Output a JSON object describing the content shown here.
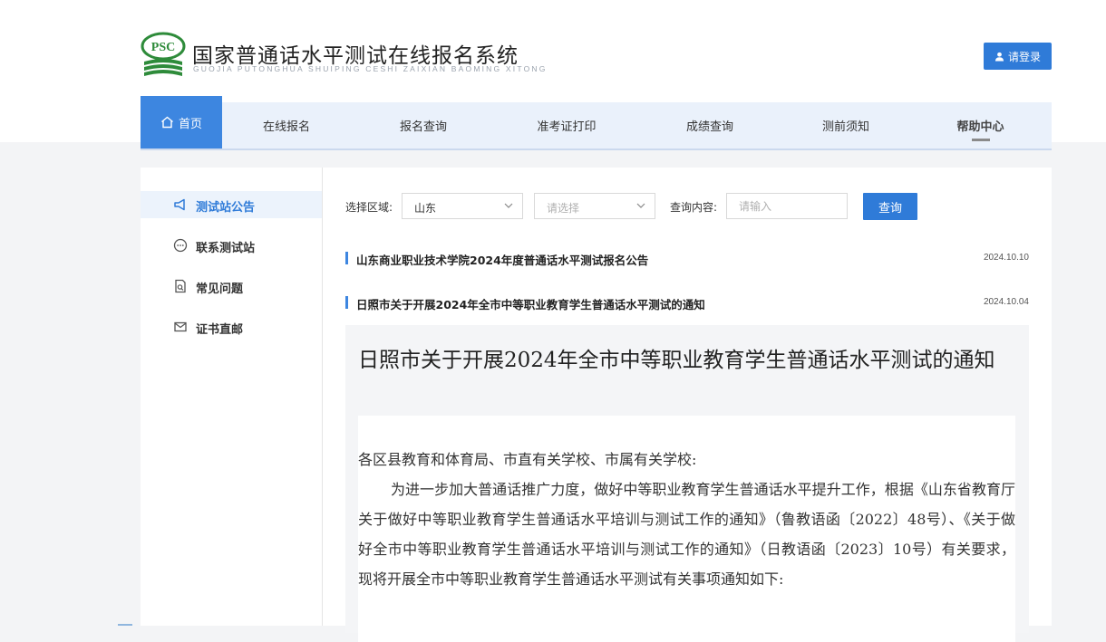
{
  "site": {
    "title": "国家普通话水平测试在线报名系统",
    "subtitle": "GUOJIA PUTONGHUA SHUIPING CESHI ZAIXIAN BAOMING XITONG",
    "logo_text": "PSC",
    "login_label": "请登录"
  },
  "nav": {
    "items": [
      {
        "label": "首页",
        "icon": "home-icon"
      },
      {
        "label": "在线报名"
      },
      {
        "label": "报名查询"
      },
      {
        "label": "准考证打印"
      },
      {
        "label": "成绩查询"
      },
      {
        "label": "测前须知"
      },
      {
        "label": "帮助中心"
      }
    ]
  },
  "sidebar": {
    "items": [
      {
        "label": "测试站公告",
        "icon": "megaphone-icon"
      },
      {
        "label": "联系测试站",
        "icon": "chat-bubble-icon"
      },
      {
        "label": "常见问题",
        "icon": "document-search-icon"
      },
      {
        "label": "证书直邮",
        "icon": "envelope-icon"
      }
    ]
  },
  "filter": {
    "region_label": "选择区域:",
    "province_value": "山东",
    "city_placeholder": "请选择",
    "content_label": "查询内容:",
    "content_placeholder": "请输入",
    "query_label": "查询"
  },
  "news": [
    {
      "title": "山东商业职业技术学院2024年度普通话水平测试报名公告",
      "date": "2024.10.10"
    },
    {
      "title": "日照市关于开展2024年全市中等职业教育学生普通话水平测试的通知",
      "date": "2024.10.04"
    }
  ],
  "detail": {
    "title": "日照市关于开展2024年全市中等职业教育学生普通话水平测试的通知",
    "greeting": "各区县教育和体育局、市直有关学校、市属有关学校:",
    "body": "为进一步加大普通话推广力度，做好中等职业教育学生普通话水平提升工作，根据《山东省教育厅 关于做好中等职业教育学生普通话水平培训与测试工作的通知》（鲁教语函〔2022〕48号）、《关于做好全市中等职业教育学生普通话水平培训与测试工作的通知》（日教语函〔2023〕10号）有关要求，现将开展全市中等职业教育学生普通话水平测试有关事项通知如下:"
  },
  "colors": {
    "primary": "#2f7bd8",
    "nav_bg": "#eaf1fb",
    "logo_green": "#2e8b3a"
  }
}
